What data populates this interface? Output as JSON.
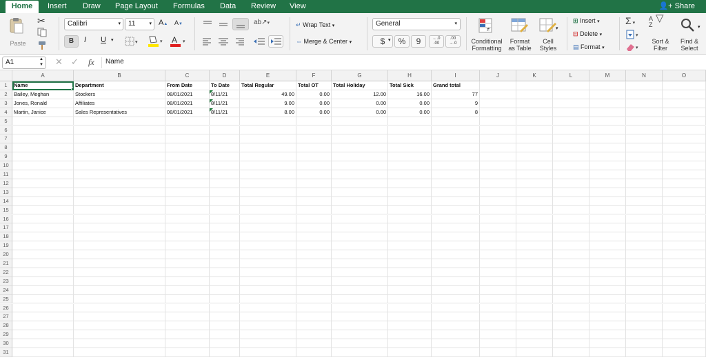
{
  "tabs": [
    "Home",
    "Insert",
    "Draw",
    "Page Layout",
    "Formulas",
    "Data",
    "Review",
    "View"
  ],
  "share_label": "Share",
  "ribbon": {
    "paste_label": "Paste",
    "font_name": "Calibri",
    "font_size": "11",
    "bold": "B",
    "italic": "I",
    "underline": "U",
    "wrap_text": "Wrap Text",
    "merge_center": "Merge & Center",
    "number_format": "General",
    "currency": "$",
    "percent": "%",
    "comma": "9",
    "conditional_formatting": [
      "Conditional",
      "Formatting"
    ],
    "format_as_table": [
      "Format",
      "as Table"
    ],
    "cell_styles": [
      "Cell",
      "Styles"
    ],
    "insert": "Insert",
    "delete": "Delete",
    "format": "Format",
    "sort_filter": [
      "Sort &",
      "Filter"
    ],
    "find_select": [
      "Find &",
      "Select"
    ],
    "accent_font_color": "#e02020",
    "accent_fill_color": "#ffe600"
  },
  "formula_bar": {
    "name_box": "A1",
    "fx": "fx",
    "content": "Name"
  },
  "columns": [
    "A",
    "B",
    "C",
    "D",
    "E",
    "F",
    "G",
    "H",
    "I",
    "J",
    "K",
    "L",
    "M",
    "N",
    "O"
  ],
  "row_count": 31,
  "table": {
    "headers": [
      "Name",
      "Department",
      "From Date",
      "To Date",
      "Total Regular",
      "Total OT",
      "Total Holiday",
      "Total Sick",
      "Grand total"
    ],
    "rows": [
      [
        "Bailey, Meghan",
        "Stockers",
        "08/01/2021",
        "8/11/21",
        "49.00",
        "0.00",
        "12.00",
        "16.00",
        "77"
      ],
      [
        "Jones, Ronald",
        "Affiliates",
        "08/01/2021",
        "8/11/21",
        "9.00",
        "0.00",
        "0.00",
        "0.00",
        "9"
      ],
      [
        "Martin, Janice",
        "Sales Representatives",
        "08/01/2021",
        "8/11/21",
        "8.00",
        "0.00",
        "0.00",
        "0.00",
        "8"
      ]
    ]
  }
}
